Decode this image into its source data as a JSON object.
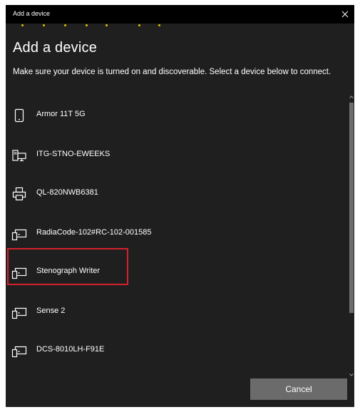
{
  "window": {
    "title": "Add a device",
    "heading": "Add a device",
    "instructions": "Make sure your device is turned on and discoverable. Select a device below to connect."
  },
  "devices": [
    {
      "label": "Armor 11T 5G",
      "icon": "phone-icon"
    },
    {
      "label": "ITG-STNO-EWEEKS",
      "icon": "computer-icon"
    },
    {
      "label": "QL-820NWB6381",
      "icon": "printer-icon"
    },
    {
      "label": "RadiaCode-102#RC-102-001585",
      "icon": "input-device-icon"
    },
    {
      "label": "Stenograph Writer",
      "icon": "input-device-icon",
      "highlighted": true
    },
    {
      "label": "Sense 2",
      "icon": "input-device-icon"
    },
    {
      "label": "DCS-8010LH-F91E",
      "icon": "input-device-icon"
    }
  ],
  "buttons": {
    "cancel": "Cancel"
  },
  "colors": {
    "background": "#1f1f1f",
    "titlebar": "#000000",
    "highlight": "#d4222b",
    "button": "#6b6b6b",
    "progress_dots": "#e0c200"
  }
}
